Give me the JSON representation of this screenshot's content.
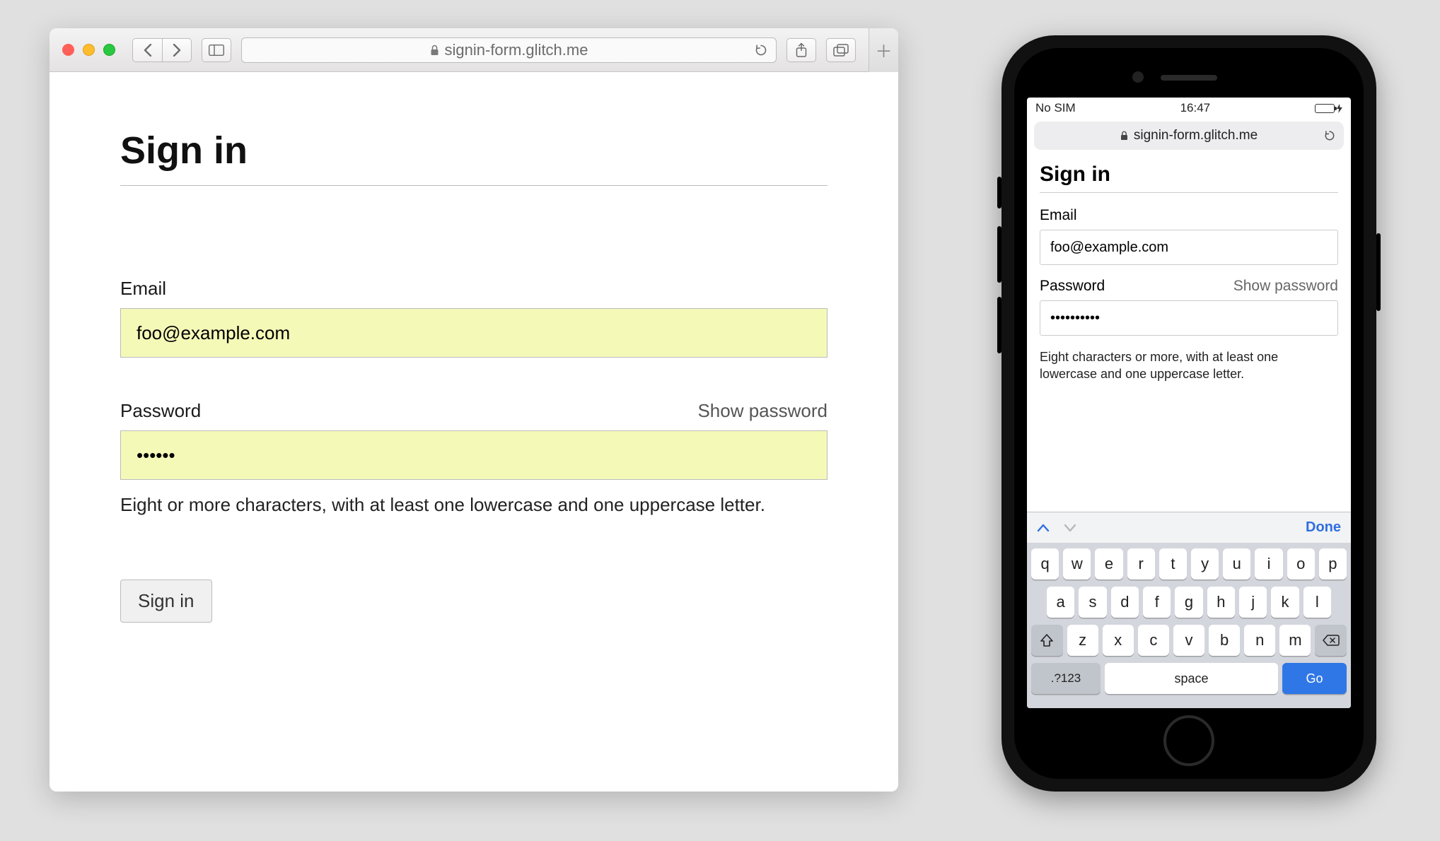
{
  "desktop": {
    "url": "signin-form.glitch.me",
    "page": {
      "title": "Sign in",
      "email_label": "Email",
      "email_value": "foo@example.com",
      "password_label": "Password",
      "show_password_label": "Show password",
      "password_value": "••••••",
      "password_hint": "Eight or more characters, with at least one lowercase and one uppercase letter.",
      "submit_label": "Sign in"
    }
  },
  "mobile": {
    "status": {
      "carrier": "No SIM",
      "time": "16:47"
    },
    "url": "signin-form.glitch.me",
    "page": {
      "title": "Sign in",
      "email_label": "Email",
      "email_value": "foo@example.com",
      "password_label": "Password",
      "show_password_label": "Show password",
      "password_value": "••••••••••",
      "password_hint": "Eight characters or more, with at least one lowercase and one uppercase letter."
    },
    "accessory": {
      "done": "Done"
    },
    "keyboard": {
      "row1": [
        "q",
        "w",
        "e",
        "r",
        "t",
        "y",
        "u",
        "i",
        "o",
        "p"
      ],
      "row2": [
        "a",
        "s",
        "d",
        "f",
        "g",
        "h",
        "j",
        "k",
        "l"
      ],
      "row3": [
        "z",
        "x",
        "c",
        "v",
        "b",
        "n",
        "m"
      ],
      "nums": ".?123",
      "space": "space",
      "go": "Go"
    }
  }
}
